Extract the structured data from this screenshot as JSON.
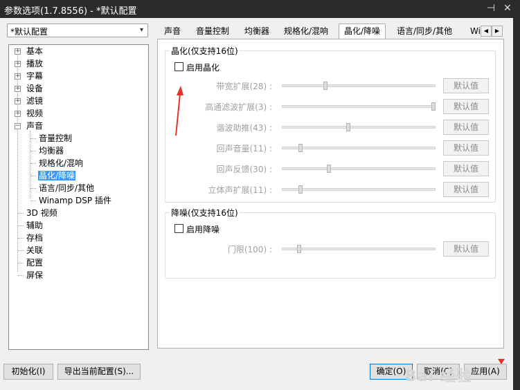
{
  "window": {
    "title": "参数选项(1.7.8556) - *默认配置",
    "pin_icon": "pin-icon",
    "close_icon": "close-icon"
  },
  "profile": {
    "value": "*默认配置"
  },
  "tree": {
    "base": "基本",
    "play": "播放",
    "subtitle": "字幕",
    "device": "设备",
    "filter": "滤镜",
    "video": "视频",
    "audio": "声音",
    "audio_children": [
      "音量控制",
      "均衡器",
      "规格化/混响",
      "晶化/降噪",
      "语言/同步/其他",
      "Winamp DSP 插件"
    ],
    "video3d": "3D 视频",
    "assist": "辅助",
    "archive": "存档",
    "assoc": "关联",
    "config": "配置",
    "screensaver": "屏保"
  },
  "tabs": [
    "声音",
    "音量控制",
    "均衡器",
    "规格化/混响",
    "晶化/降噪",
    "语言/同步/其他",
    "Wi"
  ],
  "active_tab": "晶化/降噪",
  "crystal": {
    "group_title": "晶化(仅支持16位)",
    "enable_label": "启用晶化",
    "rows": [
      {
        "label": "带宽扩展(28) :",
        "value": 28,
        "button": "默认值"
      },
      {
        "label": "高通滤波扩展(3) :",
        "value": 3,
        "button": "默认值"
      },
      {
        "label": "谐波助推(43) :",
        "value": 43,
        "button": "默认值"
      },
      {
        "label": "回声音量(11) :",
        "value": 11,
        "button": "默认值"
      },
      {
        "label": "回声反馈(30) :",
        "value": 30,
        "button": "默认值"
      },
      {
        "label": "立体声扩展(11) :",
        "value": 11,
        "button": "默认值"
      }
    ]
  },
  "denoise": {
    "group_title": "降噪(仅支持16位)",
    "enable_label": "启用降噪",
    "rows": [
      {
        "label": "门限(100) :",
        "value": 100,
        "button": "默认值"
      }
    ]
  },
  "footer": {
    "init": "初始化(I)",
    "export": "导出当前配置(S)...",
    "ok": "确定(O)",
    "cancel": "取消(C)",
    "apply": "应用(A)"
  },
  "watermark": "Bai 经验",
  "colors": {
    "accent": "#3399ff",
    "annotation": "#e5332a"
  }
}
